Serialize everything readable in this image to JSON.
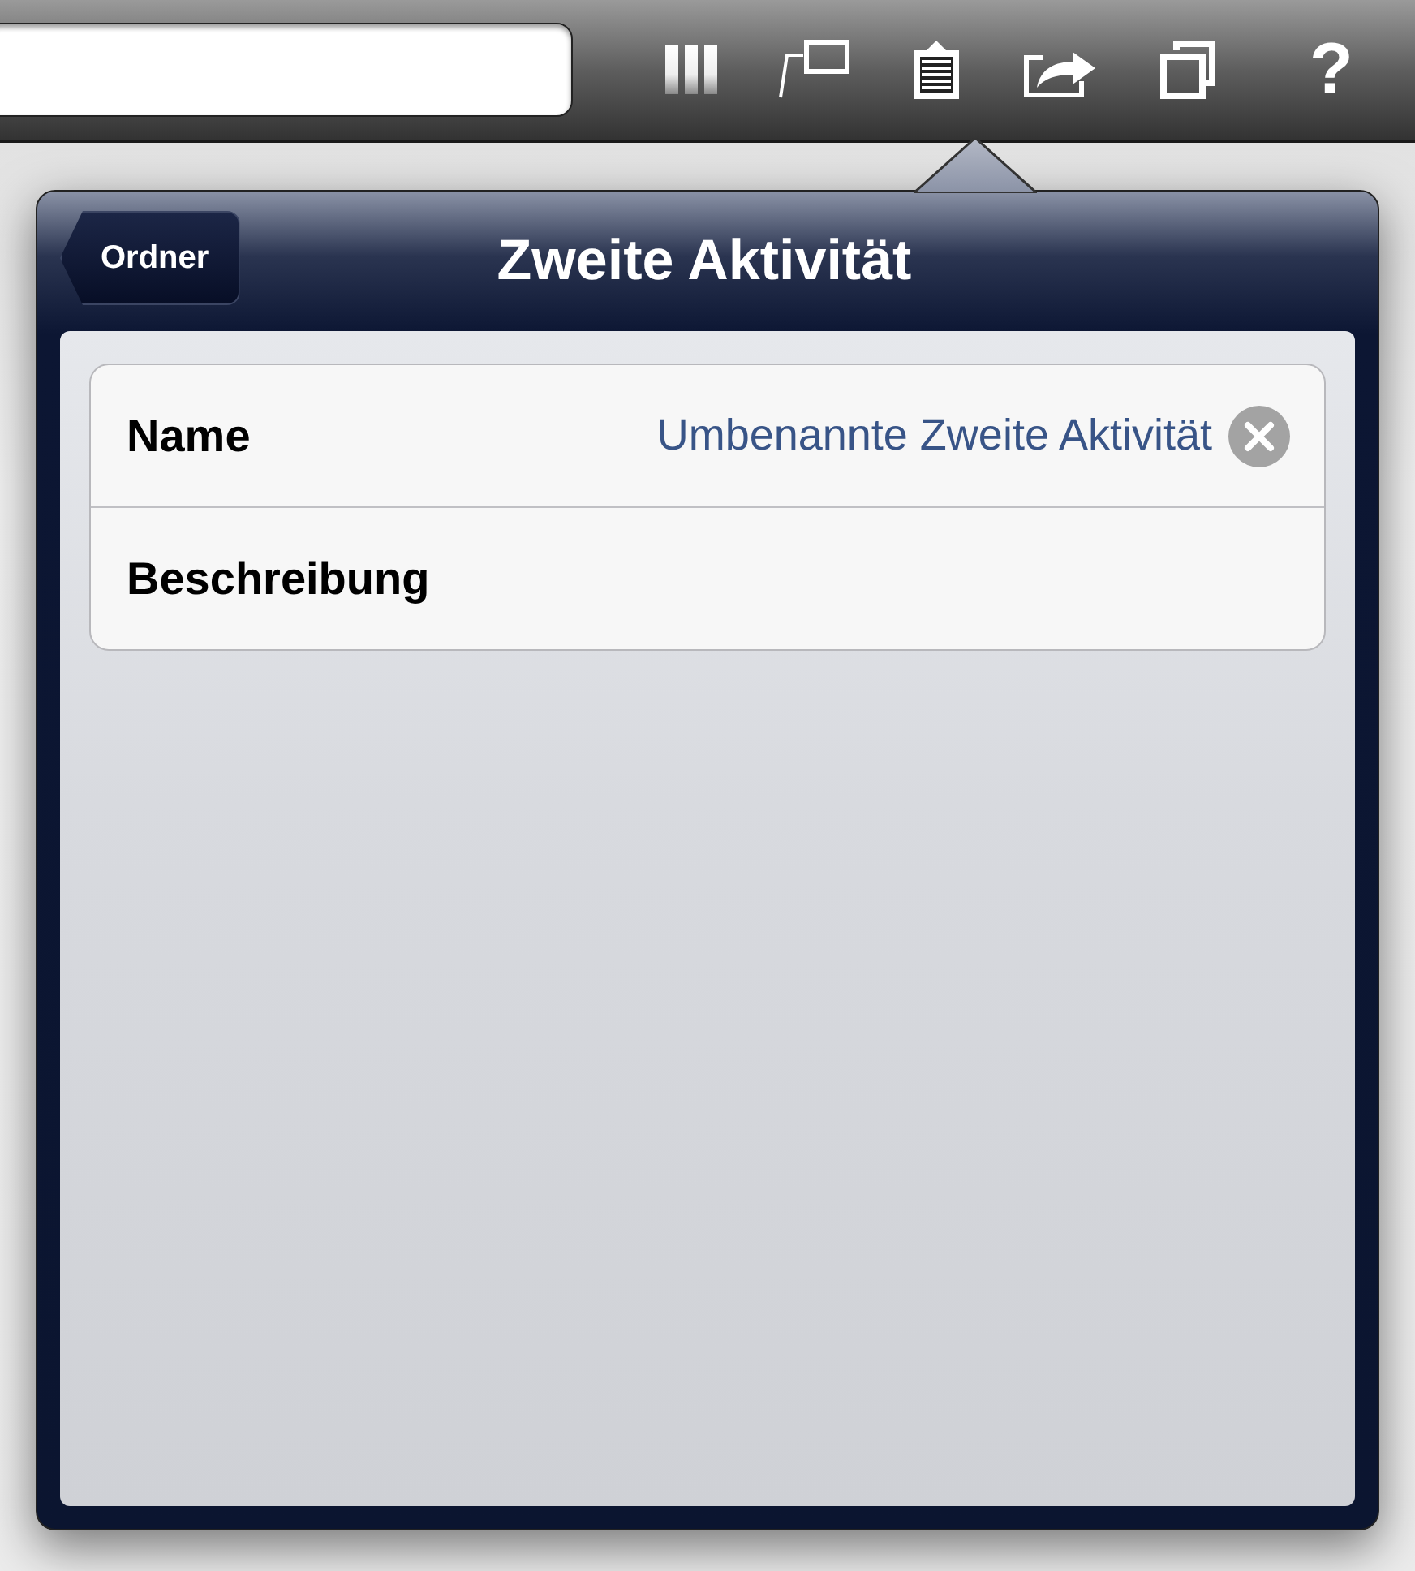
{
  "toolbar": {
    "help_glyph": "?"
  },
  "popover": {
    "back_button": "Ordner",
    "title": "Zweite Aktivität",
    "rows": [
      {
        "label": "Name",
        "value": "Umbenannte Zweite Aktivität",
        "clear_button": true
      },
      {
        "label": "Beschreibung",
        "clear_button": false
      }
    ]
  }
}
